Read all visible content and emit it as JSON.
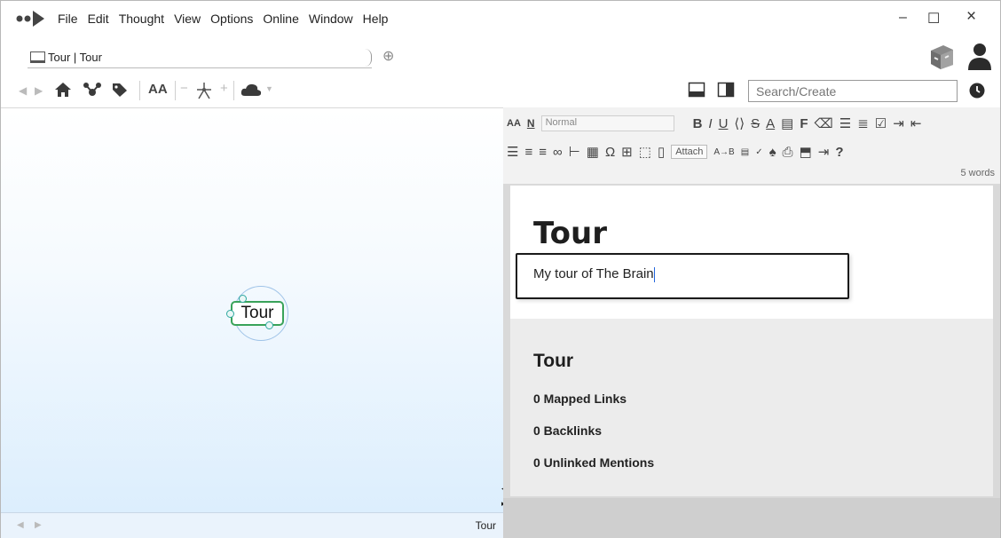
{
  "menu": {
    "items": [
      "File",
      "Edit",
      "Thought",
      "View",
      "Options",
      "Online",
      "Window",
      "Help"
    ]
  },
  "window_controls": {
    "minimize": "–",
    "maximize": "☐",
    "close": "×"
  },
  "tab": {
    "label": "Tour | Tour",
    "new_tab_icon": "⊕"
  },
  "toolbar": {
    "icons": [
      "back-icon",
      "forward-icon",
      "home-icon",
      "mind-map-icon",
      "tag-icon",
      "font-size-icon",
      "zoom-out-icon",
      "layout-icon",
      "zoom-in-icon",
      "cloud-icon"
    ],
    "font_size_label": "AA",
    "search_placeholder": "Search/Create"
  },
  "map": {
    "active_thought": "Tour",
    "status_label": "Tour",
    "node_border_color": "#3aa35a"
  },
  "editor": {
    "style_label": "Normal",
    "attach_label": "Attach",
    "word_count": "5 words",
    "format_buttons_row1": [
      "B",
      "I",
      "U",
      "F"
    ],
    "format_glyph_omega": "Ω"
  },
  "note": {
    "title": "Tour",
    "label_text": "My tour of The Brain"
  },
  "links_panel": {
    "title": "Tour",
    "mapped_links": "0 Mapped Links",
    "backlinks": "0 Backlinks",
    "unlinked_mentions": "0 Unlinked Mentions"
  }
}
